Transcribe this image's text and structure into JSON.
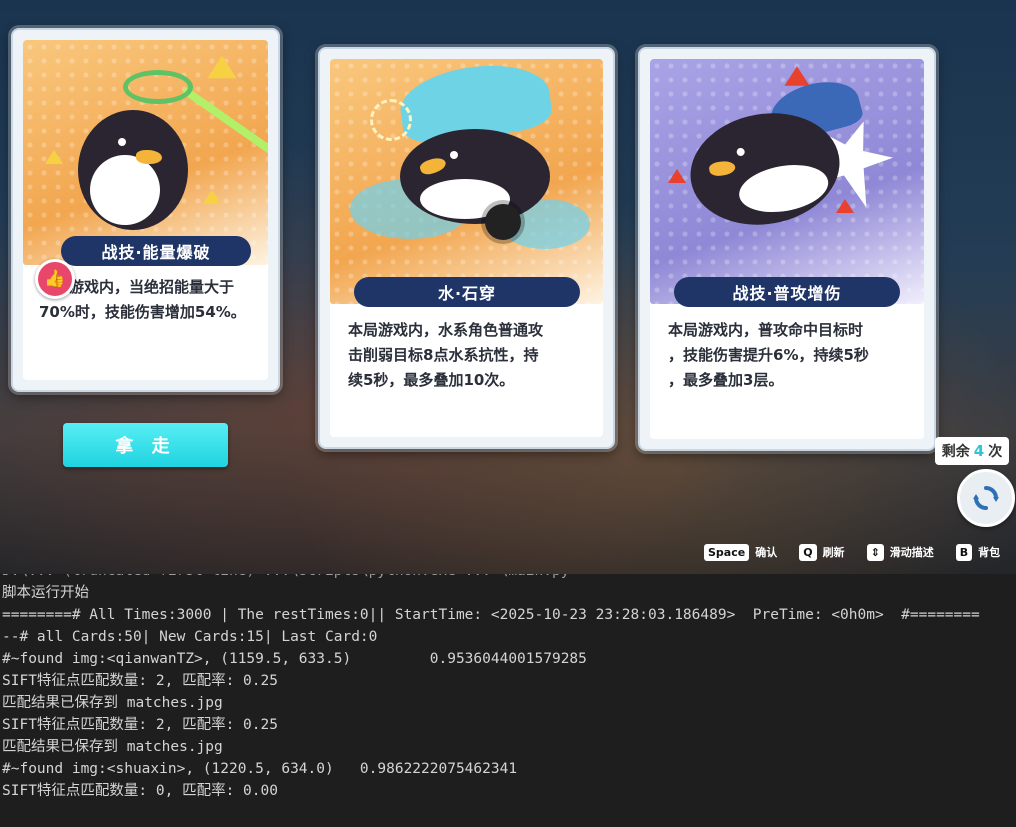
{
  "cards": [
    {
      "title": "战技·能量爆破",
      "description": "本局游戏内，当绝招能量大于\n70%时，技能伤害增加54%。"
    },
    {
      "title": "水·石穿",
      "description": "本局游戏内，水系角色普通攻\n击削弱目标8点水系抗性，持\n续5秒，最多叠加10次。"
    },
    {
      "title": "战技·普攻增伤",
      "description": "本局游戏内，普攻命中目标时\n，技能伤害提升6%，持续5秒\n，最多叠加3层。"
    }
  ],
  "take_button": "拿 走",
  "remaining": {
    "prefix": "剩余",
    "count": "4",
    "suffix": "次"
  },
  "hints": [
    {
      "key": "Space",
      "label": "确认"
    },
    {
      "key": "Q",
      "label": "刷新"
    },
    {
      "key": "⇕",
      "label": "滑动描述"
    },
    {
      "key": "B",
      "label": "背包"
    }
  ],
  "icons": {
    "thumb": "thumbs-up-icon",
    "refresh": "refresh-icon",
    "scroll": "up-down-arrows-icon"
  },
  "colors": {
    "banner": "#1f3567",
    "take_button": "#1fd3e0",
    "remaining_count": "#2ec3d6",
    "thumb_badge": "#e8476b"
  },
  "console": {
    "top_cut": "D:\\... (truncated first line) ...\\scripts\\python.exe ... \\main.py",
    "lines": [
      "脚本运行开始",
      "========# All Times:3000 | The restTimes:0|| StartTime: <2025-10-23 23:28:03.186489>  PreTime: <0h0m>  #========",
      "--# all Cards:50| New Cards:15| Last Card:0",
      "#~found img:<qianwanTZ>, (1159.5, 633.5)         0.9536044001579285",
      "SIFT特征点匹配数量: 2, 匹配率: 0.25",
      "匹配结果已保存到 matches.jpg",
      "SIFT特征点匹配数量: 2, 匹配率: 0.25",
      "匹配结果已保存到 matches.jpg",
      "#~found img:<shuaxin>, (1220.5, 634.0)   0.9862222075462341",
      "SIFT特征点匹配数量: 0, 匹配率: 0.00"
    ]
  }
}
